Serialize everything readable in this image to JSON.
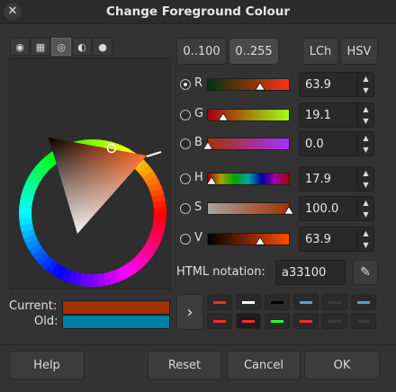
{
  "window": {
    "title": "Change Foreground Colour",
    "close_glyph": "✕"
  },
  "selector_tabs": [
    {
      "name": "wilber-icon",
      "glyph": "◉"
    },
    {
      "name": "cmyk-icon",
      "glyph": "▦"
    },
    {
      "name": "watercolor-icon",
      "glyph": "◎"
    },
    {
      "name": "wheel-icon",
      "glyph": "◐"
    },
    {
      "name": "palette-icon",
      "glyph": "●"
    }
  ],
  "range_buttons": {
    "r100": "0..100",
    "r255": "0..255"
  },
  "model_buttons": {
    "lch": "LCh",
    "hsv": "HSV"
  },
  "channels": [
    {
      "letter": "R",
      "value": "63.9",
      "selected": true,
      "fraction": 0.639,
      "gradient": "linear-gradient(to right,#003310,#ff3310)"
    },
    {
      "letter": "G",
      "value": "19.1",
      "selected": false,
      "fraction": 0.191,
      "gradient": "linear-gradient(to right,#a30010,#a3ff10)"
    },
    {
      "letter": "B",
      "value": "0.0",
      "selected": false,
      "fraction": 0.0,
      "gradient": "linear-gradient(to right,#a33300,#a333ff)"
    },
    {
      "letter": "H",
      "value": "17.9",
      "selected": false,
      "fraction": 0.0497,
      "gradient": "linear-gradient(to right,#a30000,#a3a300,#00a300,#00a3a3,#0000a3,#a300a3,#a30000)"
    },
    {
      "letter": "S",
      "value": "100.0",
      "selected": false,
      "fraction": 1.0,
      "gradient": "linear-gradient(to right,#a3a3a3,#a33100)"
    },
    {
      "letter": "V",
      "value": "63.9",
      "selected": false,
      "fraction": 0.639,
      "gradient": "linear-gradient(to right,#000000,#ff4d00)"
    }
  ],
  "html_notation": {
    "label": "HTML notation:",
    "value": "a33100",
    "picker_glyph": "✎"
  },
  "current_old": {
    "current_label": "Current:",
    "old_label": "Old:",
    "current_color": "#a33100",
    "old_color": "#007fa3"
  },
  "history": {
    "add_glyph": "›",
    "colors": [
      "#ff2a2a",
      "#ffffff",
      "#000000",
      "#6b9ab8",
      "#3a3a3a",
      "#6b9ab8",
      "#ff2a2a",
      "#ff2a2a",
      "#2aff2a",
      "#ff2a2a",
      "#3a3a3a",
      "#3a3a3a"
    ]
  },
  "buttons": {
    "help": "Help",
    "reset": "Reset",
    "cancel": "Cancel",
    "ok": "OK"
  }
}
